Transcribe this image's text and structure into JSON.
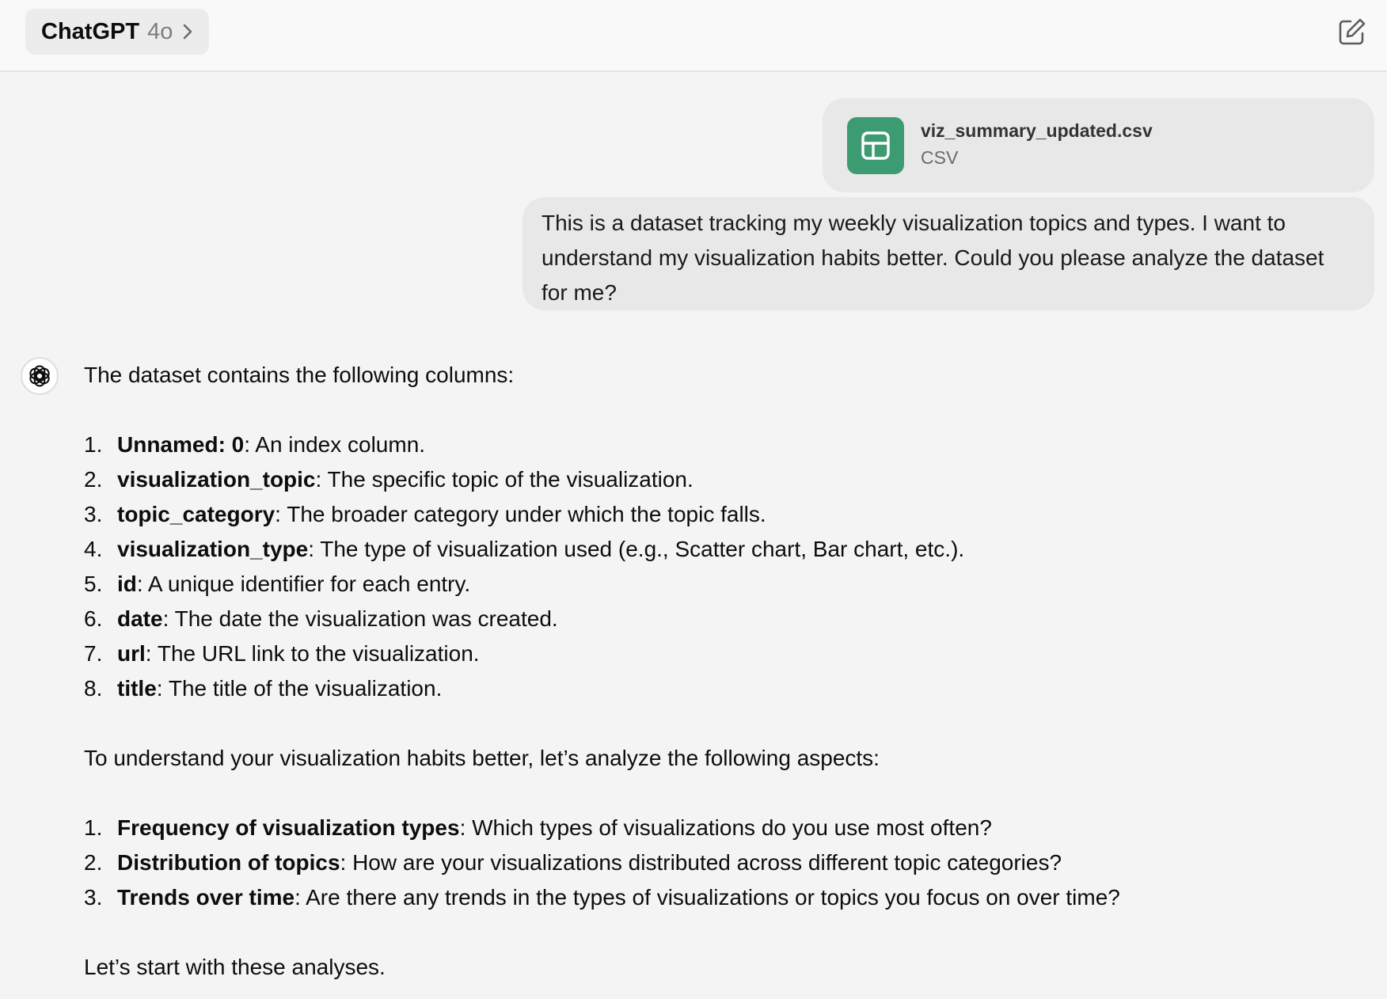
{
  "header": {
    "model_name": "ChatGPT",
    "model_version": "4o"
  },
  "icons": {
    "chevron": "chevron-right-icon",
    "new_chat": "new-chat-icon",
    "file": "table-icon",
    "assistant": "openai-logo-icon"
  },
  "colors": {
    "file_tile": "#3d9b72",
    "bubble": "#e8e8e8",
    "background": "#f4f4f4"
  },
  "attachment": {
    "file_name": "viz_summary_updated.csv",
    "file_type": "CSV"
  },
  "user_message": {
    "line1": "This is a dataset tracking my weekly visualization topics and types. I want to",
    "line2": "understand my visualization habits better. Could you please analyze the dataset",
    "line3": "for me?"
  },
  "assistant_message": {
    "intro": "The dataset contains the following columns:",
    "columns": [
      {
        "num": "1.",
        "term": "Unnamed: 0",
        "desc": ": An index column."
      },
      {
        "num": "2.",
        "term": "visualization_topic",
        "desc": ": The specific topic of the visualization."
      },
      {
        "num": "3.",
        "term": "topic_category",
        "desc": ": The broader category under which the topic falls."
      },
      {
        "num": "4.",
        "term": "visualization_type",
        "desc": ": The type of visualization used (e.g., Scatter chart, Bar chart, etc.)."
      },
      {
        "num": "5.",
        "term": "id",
        "desc": ": A unique identifier for each entry."
      },
      {
        "num": "6.",
        "term": "date",
        "desc": ": The date the visualization was created."
      },
      {
        "num": "7.",
        "term": "url",
        "desc": ": The URL link to the visualization."
      },
      {
        "num": "8.",
        "term": "title",
        "desc": ": The title of the visualization."
      }
    ],
    "aspects_intro": "To understand your visualization habits better, let’s analyze the following aspects:",
    "aspects": [
      {
        "num": "1.",
        "term": "Frequency of visualization types",
        "desc": ": Which types of visualizations do you use most often?"
      },
      {
        "num": "2.",
        "term": "Distribution of topics",
        "desc": ": How are your visualizations distributed across different topic categories?"
      },
      {
        "num": "3.",
        "term": "Trends over time",
        "desc": ": Are there any trends in the types of visualizations or topics you focus on over time?"
      }
    ],
    "closing": "Let’s start with these analyses."
  }
}
